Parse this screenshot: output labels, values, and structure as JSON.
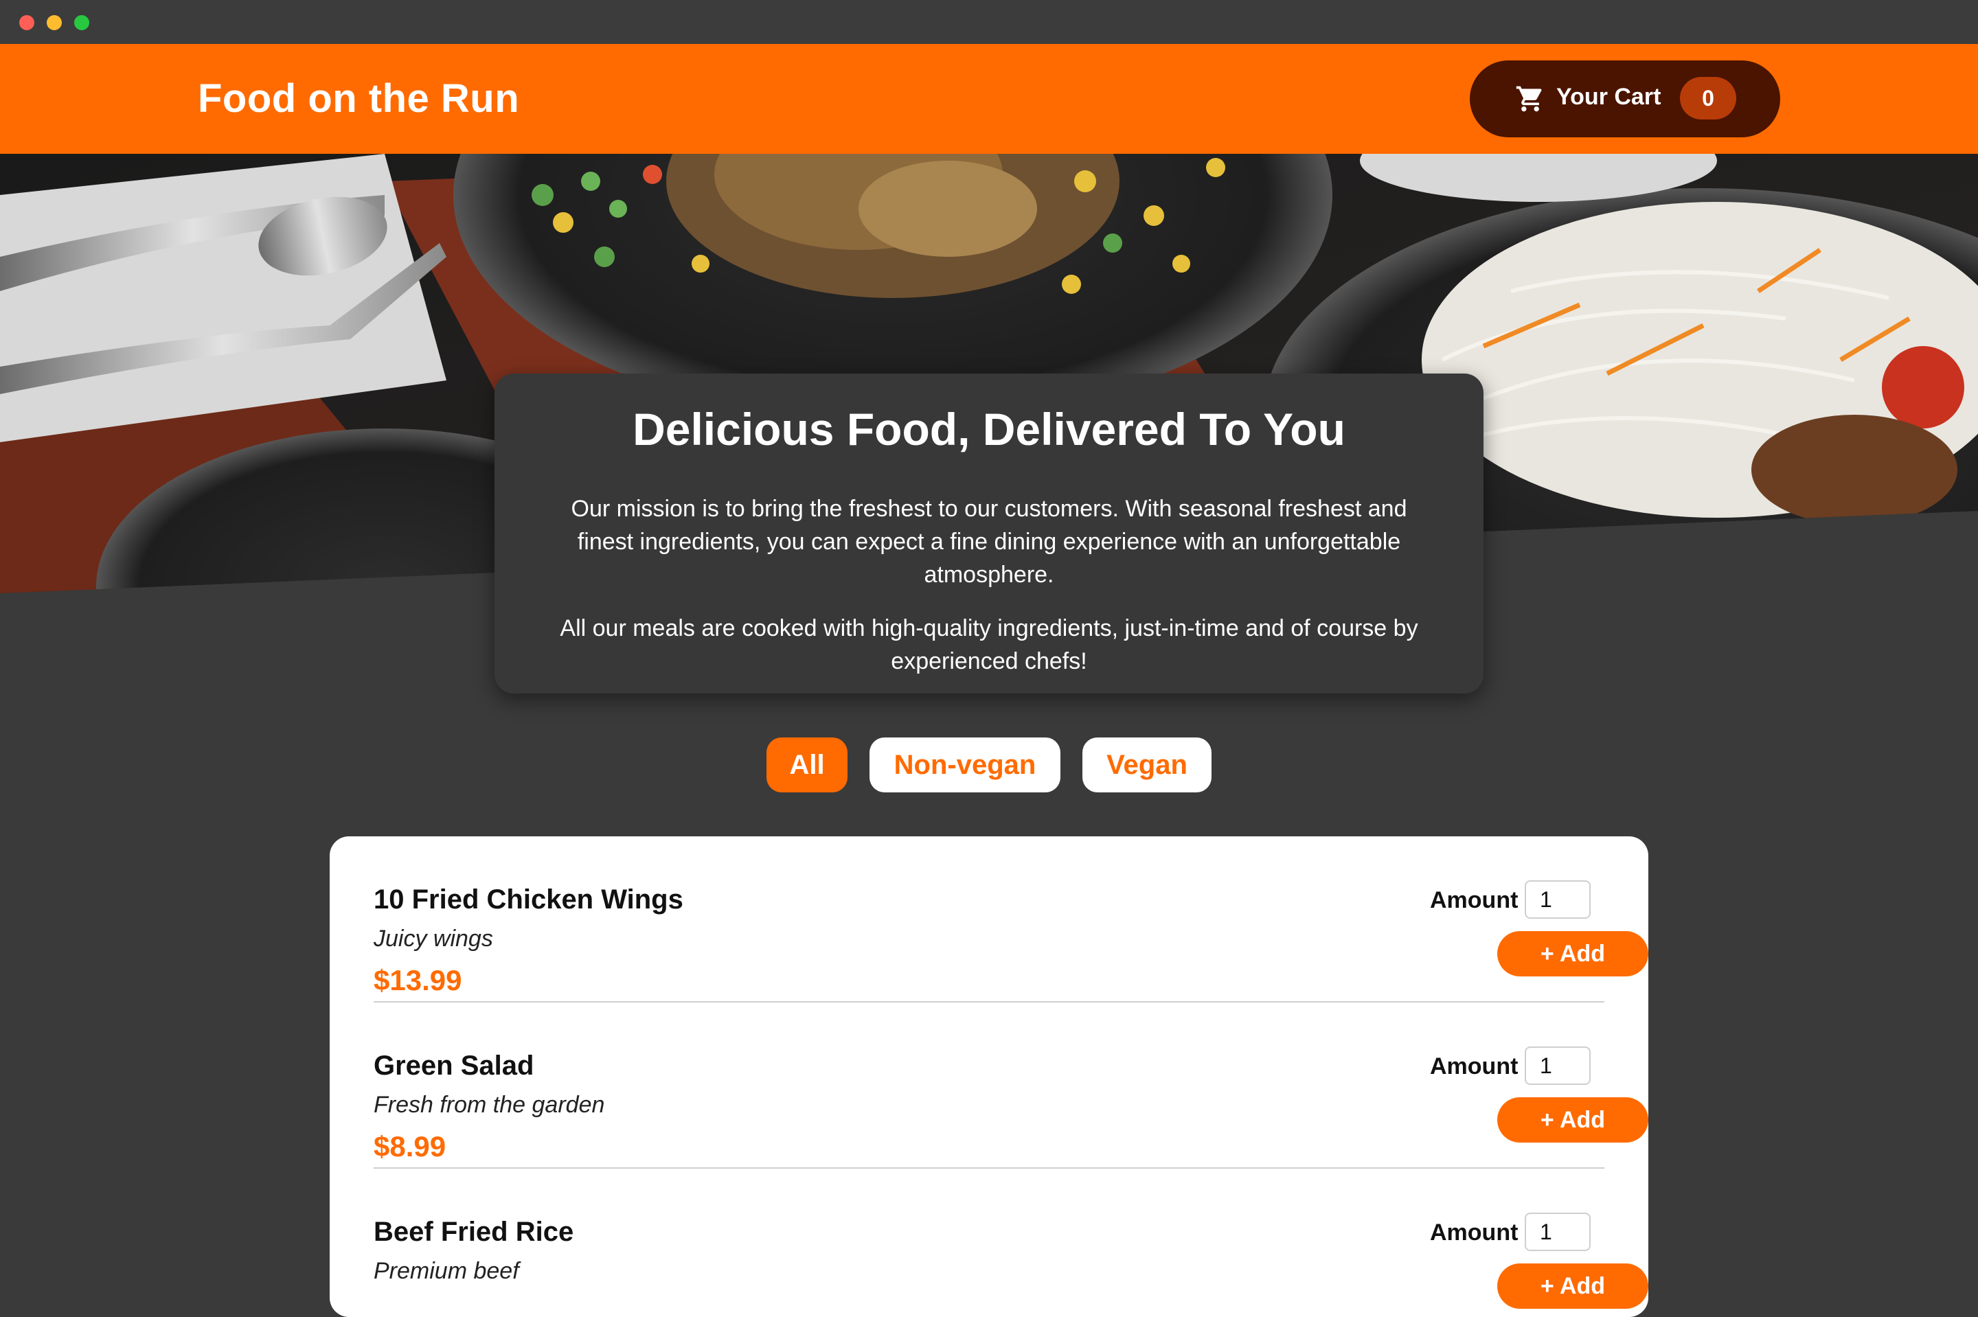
{
  "header": {
    "title": "Food on the Run",
    "cart": {
      "label": "Your Cart",
      "count": "0",
      "icon": "cart-icon"
    }
  },
  "hero": {
    "image": "table of plated dishes with cutlery, sizzling plates and shredded cabbage salad"
  },
  "summary": {
    "heading": "Delicious Food, Delivered To You",
    "paragraph1": "Our mission is to bring the freshest to our customers. With seasonal freshest and finest ingredients, you can expect a fine dining experience with an unforgettable atmosphere.",
    "paragraph2": "All our meals are cooked with high-quality ingredients, just-in-time and of course by experienced chefs!"
  },
  "filters": {
    "active": "All",
    "items": [
      "All",
      "Non-vegan",
      "Vegan"
    ]
  },
  "meals": [
    {
      "name": "10 Fried Chicken Wings",
      "description": "Juicy wings",
      "price": "$13.99",
      "amount_label": "Amount",
      "amount": "1",
      "add_label": "+ Add"
    },
    {
      "name": "Green Salad",
      "description": "Fresh from the garden",
      "price": "$8.99",
      "amount_label": "Amount",
      "amount": "1",
      "add_label": "+ Add"
    },
    {
      "name": "Beef Fried Rice",
      "description": "Premium beef",
      "price": "",
      "amount_label": "Amount",
      "amount": "1",
      "add_label": "+ Add"
    }
  ],
  "colors": {
    "accent": "#ff6b00",
    "cart_bg": "#4a1400",
    "badge_bg": "#b83c08",
    "page_bg": "#3a3a3a",
    "summary_bg": "#383838"
  }
}
